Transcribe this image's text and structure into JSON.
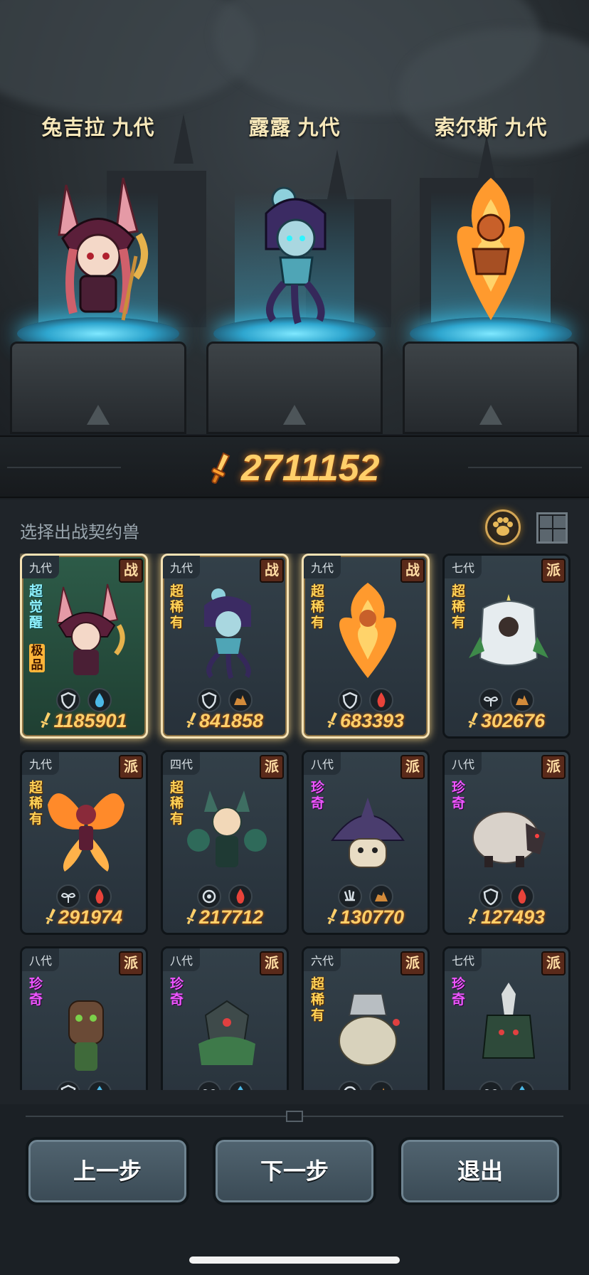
{
  "heroes": [
    {
      "name": "兔吉拉 九代"
    },
    {
      "name": "露露 九代"
    },
    {
      "name": "索尔斯 九代"
    }
  ],
  "total_power": "2711152",
  "panel": {
    "title": "选择出战契约兽"
  },
  "cards": [
    {
      "gen": "九代",
      "role": "战",
      "rarity": "超觉醒",
      "quality": "极品",
      "power": "1185901",
      "selected": true
    },
    {
      "gen": "九代",
      "role": "战",
      "rarity": "超稀有",
      "quality": "",
      "power": "841858",
      "selected": true
    },
    {
      "gen": "九代",
      "role": "战",
      "rarity": "超稀有",
      "quality": "",
      "power": "683393",
      "selected": true
    },
    {
      "gen": "七代",
      "role": "派",
      "rarity": "超稀有",
      "quality": "",
      "power": "302676",
      "selected": false
    },
    {
      "gen": "九代",
      "role": "派",
      "rarity": "超稀有",
      "quality": "",
      "power": "291974",
      "selected": false
    },
    {
      "gen": "四代",
      "role": "派",
      "rarity": "超稀有",
      "quality": "",
      "power": "217712",
      "selected": false
    },
    {
      "gen": "八代",
      "role": "派",
      "rarity": "珍奇",
      "quality": "",
      "power": "130770",
      "selected": false
    },
    {
      "gen": "八代",
      "role": "派",
      "rarity": "珍奇",
      "quality": "",
      "power": "127493",
      "selected": false
    },
    {
      "gen": "八代",
      "role": "派",
      "rarity": "珍奇",
      "quality": "",
      "power": "",
      "selected": false
    },
    {
      "gen": "八代",
      "role": "派",
      "rarity": "珍奇",
      "quality": "",
      "power": "",
      "selected": false
    },
    {
      "gen": "六代",
      "role": "派",
      "rarity": "超稀有",
      "quality": "",
      "power": "",
      "selected": false
    },
    {
      "gen": "七代",
      "role": "派",
      "rarity": "珍奇",
      "quality": "",
      "power": "",
      "selected": false
    }
  ],
  "buttons": {
    "prev": "上一步",
    "next": "下一步",
    "exit": "退出"
  },
  "colors": {
    "power_gold": "#ffcf6a",
    "selected_border": "#f5e2b4",
    "role_badge": "#5a2a1a",
    "rare_gold": "#ffd257",
    "rare_purple": "#ee56ff"
  }
}
